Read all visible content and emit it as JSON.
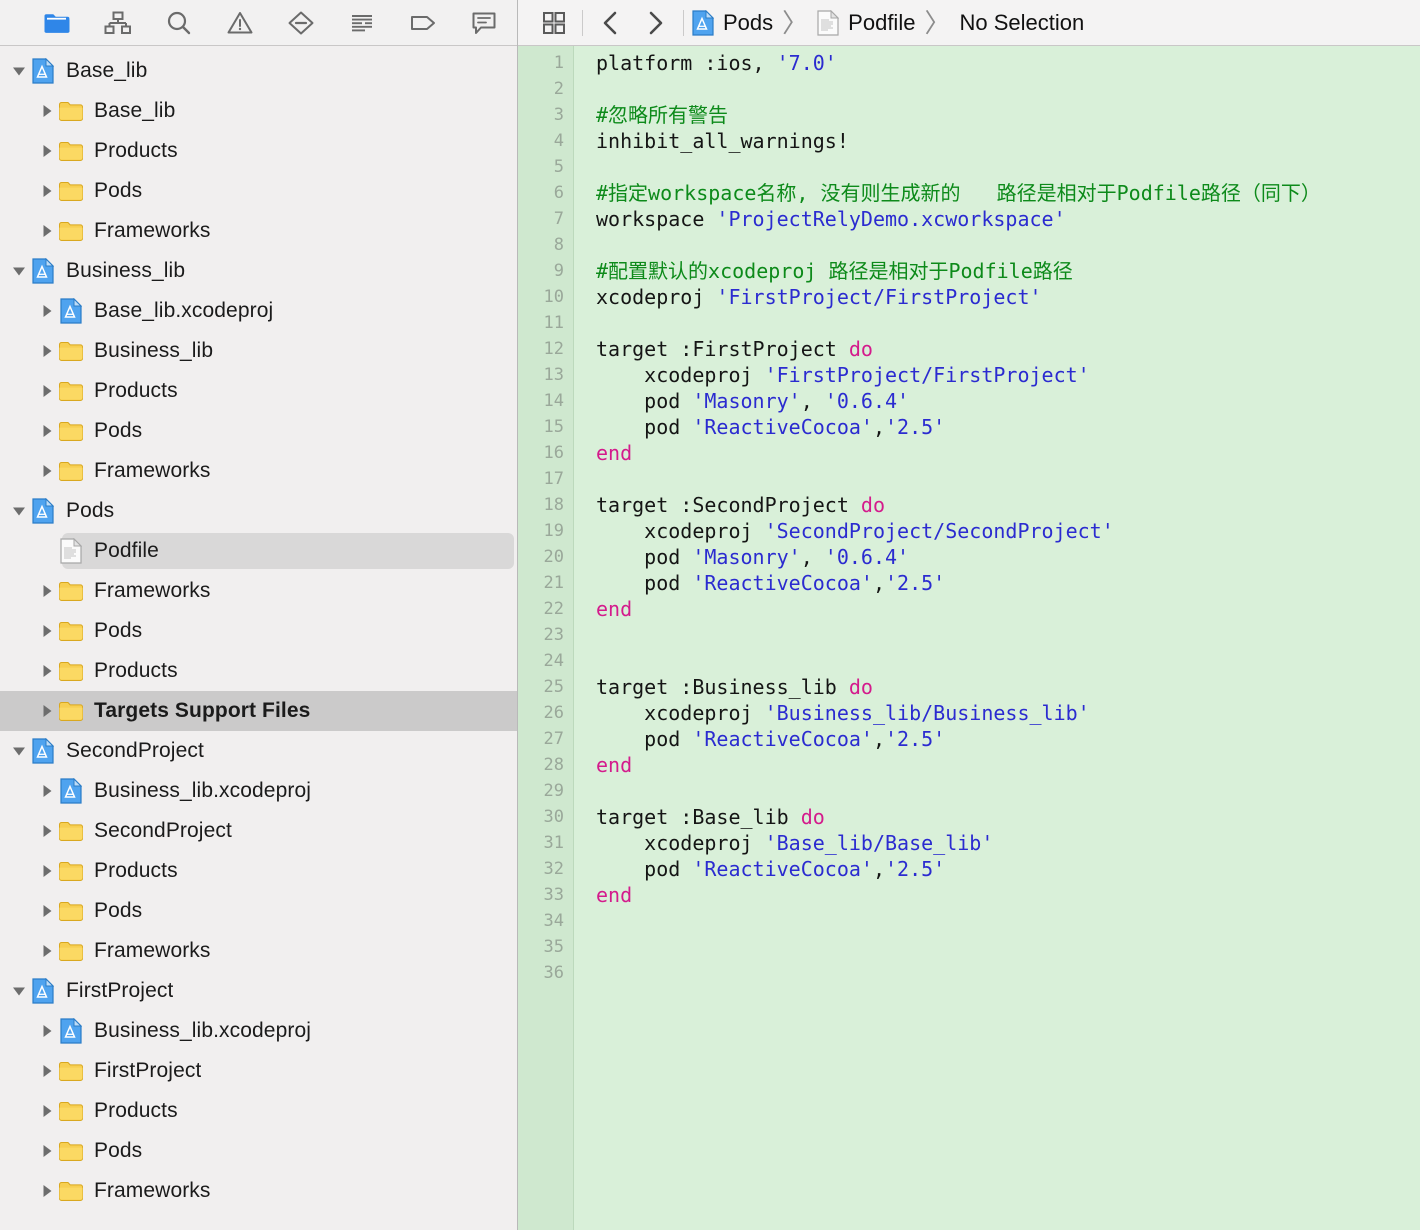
{
  "navigator": {
    "toolbar": {
      "items": [
        {
          "name": "project-navigator-icon",
          "label": "Project Navigator",
          "active": true
        },
        {
          "name": "symbol-navigator-icon",
          "label": "Symbol Navigator",
          "active": false
        },
        {
          "name": "search-icon",
          "label": "Find Navigator",
          "active": false
        },
        {
          "name": "warning-triangle-icon",
          "label": "Issue Navigator",
          "active": false
        },
        {
          "name": "debug-icon",
          "label": "Debug Navigator",
          "active": false
        },
        {
          "name": "test-report-icon",
          "label": "Test Navigator",
          "active": false
        },
        {
          "name": "breakpoint-tag-icon",
          "label": "Breakpoint Navigator",
          "active": false
        },
        {
          "name": "report-bubble-icon",
          "label": "Report Navigator",
          "active": false
        }
      ]
    },
    "tree": [
      {
        "label": "Base_lib",
        "icon": "xcodeproj",
        "depth": 0,
        "disclosure": "open",
        "state": "normal"
      },
      {
        "label": "Base_lib",
        "icon": "folder",
        "depth": 1,
        "disclosure": "closed",
        "state": "normal"
      },
      {
        "label": "Products",
        "icon": "folder",
        "depth": 1,
        "disclosure": "closed",
        "state": "normal"
      },
      {
        "label": "Pods",
        "icon": "folder",
        "depth": 1,
        "disclosure": "closed",
        "state": "normal"
      },
      {
        "label": "Frameworks",
        "icon": "folder",
        "depth": 1,
        "disclosure": "closed",
        "state": "normal"
      },
      {
        "label": "Business_lib",
        "icon": "xcodeproj",
        "depth": 0,
        "disclosure": "open",
        "state": "normal"
      },
      {
        "label": "Base_lib.xcodeproj",
        "icon": "xcodeproj",
        "depth": 1,
        "disclosure": "closed",
        "state": "normal"
      },
      {
        "label": "Business_lib",
        "icon": "folder",
        "depth": 1,
        "disclosure": "closed",
        "state": "normal"
      },
      {
        "label": "Products",
        "icon": "folder",
        "depth": 1,
        "disclosure": "closed",
        "state": "normal"
      },
      {
        "label": "Pods",
        "icon": "folder",
        "depth": 1,
        "disclosure": "closed",
        "state": "normal"
      },
      {
        "label": "Frameworks",
        "icon": "folder",
        "depth": 1,
        "disclosure": "closed",
        "state": "normal"
      },
      {
        "label": "Pods",
        "icon": "xcodeproj",
        "depth": 0,
        "disclosure": "open",
        "state": "normal"
      },
      {
        "label": "Podfile",
        "icon": "document",
        "depth": 1,
        "disclosure": "none",
        "state": "selected-file"
      },
      {
        "label": "Frameworks",
        "icon": "folder",
        "depth": 1,
        "disclosure": "closed",
        "state": "normal"
      },
      {
        "label": "Pods",
        "icon": "folder",
        "depth": 1,
        "disclosure": "closed",
        "state": "normal"
      },
      {
        "label": "Products",
        "icon": "folder",
        "depth": 1,
        "disclosure": "closed",
        "state": "normal"
      },
      {
        "label": "Targets Support Files",
        "icon": "folder",
        "depth": 1,
        "disclosure": "closed",
        "state": "highlighted"
      },
      {
        "label": "SecondProject",
        "icon": "xcodeproj",
        "depth": 0,
        "disclosure": "open",
        "state": "normal"
      },
      {
        "label": "Business_lib.xcodeproj",
        "icon": "xcodeproj",
        "depth": 1,
        "disclosure": "closed",
        "state": "normal"
      },
      {
        "label": "SecondProject",
        "icon": "folder",
        "depth": 1,
        "disclosure": "closed",
        "state": "normal"
      },
      {
        "label": "Products",
        "icon": "folder",
        "depth": 1,
        "disclosure": "closed",
        "state": "normal"
      },
      {
        "label": "Pods",
        "icon": "folder",
        "depth": 1,
        "disclosure": "closed",
        "state": "normal"
      },
      {
        "label": "Frameworks",
        "icon": "folder",
        "depth": 1,
        "disclosure": "closed",
        "state": "normal"
      },
      {
        "label": "FirstProject",
        "icon": "xcodeproj",
        "depth": 0,
        "disclosure": "open",
        "state": "normal"
      },
      {
        "label": "Business_lib.xcodeproj",
        "icon": "xcodeproj",
        "depth": 1,
        "disclosure": "closed",
        "state": "normal"
      },
      {
        "label": "FirstProject",
        "icon": "folder",
        "depth": 1,
        "disclosure": "closed",
        "state": "normal"
      },
      {
        "label": "Products",
        "icon": "folder",
        "depth": 1,
        "disclosure": "closed",
        "state": "normal"
      },
      {
        "label": "Pods",
        "icon": "folder",
        "depth": 1,
        "disclosure": "closed",
        "state": "normal"
      },
      {
        "label": "Frameworks",
        "icon": "folder",
        "depth": 1,
        "disclosure": "closed",
        "state": "normal"
      }
    ]
  },
  "editor": {
    "toolbar": {
      "related_items_label": "Related Items",
      "back_label": "Back",
      "forward_label": "Forward"
    },
    "breadcrumb": [
      {
        "label": "Pods",
        "icon": "xcodeproj"
      },
      {
        "label": "Podfile",
        "icon": "document"
      },
      {
        "label": "No Selection",
        "icon": "none"
      }
    ],
    "file_name": "Podfile",
    "language": "ruby",
    "total_lines": 36,
    "lines": [
      {
        "n": 1,
        "tokens": [
          {
            "t": "txt",
            "v": "platform :ios, "
          },
          {
            "t": "str",
            "v": "'7.0'"
          }
        ]
      },
      {
        "n": 2,
        "tokens": []
      },
      {
        "n": 3,
        "tokens": [
          {
            "t": "com",
            "v": "#忽略所有警告"
          }
        ]
      },
      {
        "n": 4,
        "tokens": [
          {
            "t": "txt",
            "v": "inhibit_all_warnings!"
          }
        ]
      },
      {
        "n": 5,
        "tokens": []
      },
      {
        "n": 6,
        "tokens": [
          {
            "t": "com",
            "v": "#指定workspace名称, 没有则生成新的   路径是相对于Podfile路径（同下）"
          }
        ]
      },
      {
        "n": 7,
        "tokens": [
          {
            "t": "txt",
            "v": "workspace "
          },
          {
            "t": "str",
            "v": "'ProjectRelyDemo.xcworkspace'"
          }
        ]
      },
      {
        "n": 8,
        "tokens": []
      },
      {
        "n": 9,
        "tokens": [
          {
            "t": "com",
            "v": "#配置默认的xcodeproj 路径是相对于Podfile路径"
          }
        ]
      },
      {
        "n": 10,
        "tokens": [
          {
            "t": "txt",
            "v": "xcodeproj "
          },
          {
            "t": "str",
            "v": "'FirstProject/FirstProject'"
          }
        ]
      },
      {
        "n": 11,
        "tokens": []
      },
      {
        "n": 12,
        "tokens": [
          {
            "t": "txt",
            "v": "target :FirstProject "
          },
          {
            "t": "kw",
            "v": "do"
          }
        ]
      },
      {
        "n": 13,
        "tokens": [
          {
            "t": "txt",
            "v": "    xcodeproj "
          },
          {
            "t": "str",
            "v": "'FirstProject/FirstProject'"
          }
        ]
      },
      {
        "n": 14,
        "tokens": [
          {
            "t": "txt",
            "v": "    pod "
          },
          {
            "t": "str",
            "v": "'Masonry'"
          },
          {
            "t": "txt",
            "v": ", "
          },
          {
            "t": "str",
            "v": "'0.6.4'"
          }
        ]
      },
      {
        "n": 15,
        "tokens": [
          {
            "t": "txt",
            "v": "    pod "
          },
          {
            "t": "str",
            "v": "'ReactiveCocoa'"
          },
          {
            "t": "txt",
            "v": ","
          },
          {
            "t": "str",
            "v": "'2.5'"
          }
        ]
      },
      {
        "n": 16,
        "tokens": [
          {
            "t": "kw",
            "v": "end"
          }
        ]
      },
      {
        "n": 17,
        "tokens": []
      },
      {
        "n": 18,
        "tokens": [
          {
            "t": "txt",
            "v": "target :SecondProject "
          },
          {
            "t": "kw",
            "v": "do"
          }
        ]
      },
      {
        "n": 19,
        "tokens": [
          {
            "t": "txt",
            "v": "    xcodeproj "
          },
          {
            "t": "str",
            "v": "'SecondProject/SecondProject'"
          }
        ]
      },
      {
        "n": 20,
        "tokens": [
          {
            "t": "txt",
            "v": "    pod "
          },
          {
            "t": "str",
            "v": "'Masonry'"
          },
          {
            "t": "txt",
            "v": ", "
          },
          {
            "t": "str",
            "v": "'0.6.4'"
          }
        ]
      },
      {
        "n": 21,
        "tokens": [
          {
            "t": "txt",
            "v": "    pod "
          },
          {
            "t": "str",
            "v": "'ReactiveCocoa'"
          },
          {
            "t": "txt",
            "v": ","
          },
          {
            "t": "str",
            "v": "'2.5'"
          }
        ]
      },
      {
        "n": 22,
        "tokens": [
          {
            "t": "kw",
            "v": "end"
          }
        ]
      },
      {
        "n": 23,
        "tokens": []
      },
      {
        "n": 24,
        "tokens": []
      },
      {
        "n": 25,
        "tokens": [
          {
            "t": "txt",
            "v": "target :Business_lib "
          },
          {
            "t": "kw",
            "v": "do"
          }
        ]
      },
      {
        "n": 26,
        "tokens": [
          {
            "t": "txt",
            "v": "    xcodeproj "
          },
          {
            "t": "str",
            "v": "'Business_lib/Business_lib'"
          }
        ]
      },
      {
        "n": 27,
        "tokens": [
          {
            "t": "txt",
            "v": "    pod "
          },
          {
            "t": "str",
            "v": "'ReactiveCocoa'"
          },
          {
            "t": "txt",
            "v": ","
          },
          {
            "t": "str",
            "v": "'2.5'"
          }
        ]
      },
      {
        "n": 28,
        "tokens": [
          {
            "t": "kw",
            "v": "end"
          }
        ]
      },
      {
        "n": 29,
        "tokens": []
      },
      {
        "n": 30,
        "tokens": [
          {
            "t": "txt",
            "v": "target :Base_lib "
          },
          {
            "t": "kw",
            "v": "do"
          }
        ]
      },
      {
        "n": 31,
        "tokens": [
          {
            "t": "txt",
            "v": "    xcodeproj "
          },
          {
            "t": "str",
            "v": "'Base_lib/Base_lib'"
          }
        ]
      },
      {
        "n": 32,
        "tokens": [
          {
            "t": "txt",
            "v": "    pod "
          },
          {
            "t": "str",
            "v": "'ReactiveCocoa'"
          },
          {
            "t": "txt",
            "v": ","
          },
          {
            "t": "str",
            "v": "'2.5'"
          }
        ]
      },
      {
        "n": 33,
        "tokens": [
          {
            "t": "kw",
            "v": "end"
          }
        ]
      },
      {
        "n": 34,
        "tokens": []
      },
      {
        "n": 35,
        "tokens": []
      },
      {
        "n": 36,
        "tokens": []
      }
    ]
  },
  "colors": {
    "editor_background": "#d9f0d9",
    "gutter_background": "#cfe8cf",
    "sidebar_background": "#f1efef",
    "comment": "#0d8a1a",
    "string": "#2b2bd0",
    "keyword": "#d41b8c",
    "plain_text": "#151515",
    "accent_blue": "#3b82e6",
    "folder_yellow": "#f6c944",
    "selection_gray": "#d9d8d8",
    "row_highlight_gray": "#cbcaca"
  }
}
